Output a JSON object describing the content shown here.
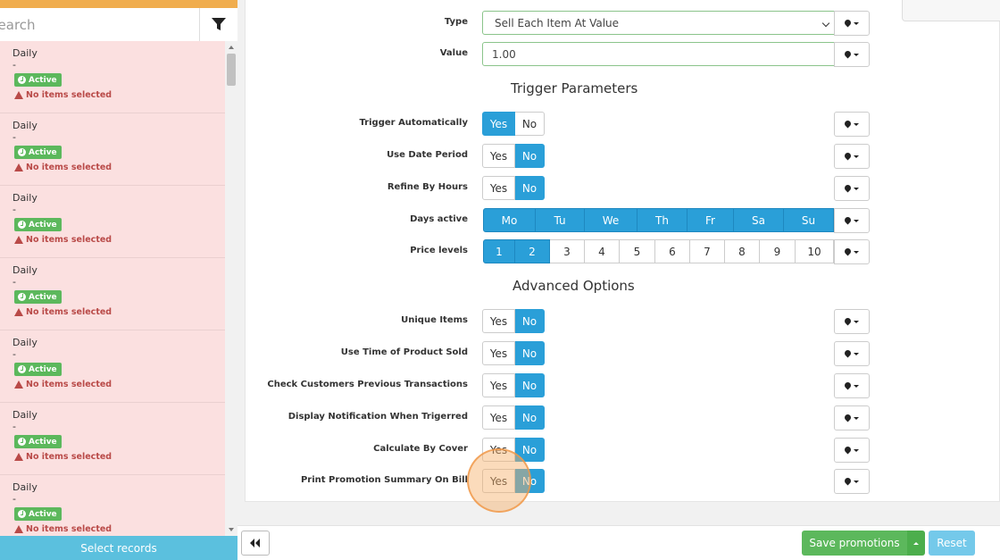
{
  "sidebar": {
    "search_placeholder": "Search",
    "records": [
      {
        "title": "Daily",
        "sub": "-",
        "status": "Active",
        "warning": "No items selected"
      },
      {
        "title": "Daily",
        "sub": "-",
        "status": "Active",
        "warning": "No items selected"
      },
      {
        "title": "Daily",
        "sub": "-",
        "status": "Active",
        "warning": "No items selected"
      },
      {
        "title": "Daily",
        "sub": "-",
        "status": "Active",
        "warning": "No items selected"
      },
      {
        "title": "Daily",
        "sub": "-",
        "status": "Active",
        "warning": "No items selected"
      },
      {
        "title": "Daily",
        "sub": "-",
        "status": "Active",
        "warning": "No items selected"
      },
      {
        "title": "Daily",
        "sub": "-",
        "status": "Active",
        "warning": "No items selected"
      }
    ],
    "select_records_label": "Select records"
  },
  "form": {
    "type": {
      "label": "Type",
      "value": "Sell Each Item At Value"
    },
    "value": {
      "label": "Value",
      "value": "1.00"
    },
    "trigger_section": "Trigger Parameters",
    "trigger_automatically": {
      "label": "Trigger Automatically",
      "yes": "Yes",
      "no": "No",
      "selected": "Yes"
    },
    "use_date_period": {
      "label": "Use Date Period",
      "yes": "Yes",
      "no": "No",
      "selected": "No"
    },
    "refine_by_hours": {
      "label": "Refine By Hours",
      "yes": "Yes",
      "no": "No",
      "selected": "No"
    },
    "days_active": {
      "label": "Days active",
      "days": [
        "Mo",
        "Tu",
        "We",
        "Th",
        "Fr",
        "Sa",
        "Su"
      ]
    },
    "price_levels": {
      "label": "Price levels",
      "levels": [
        "1",
        "2",
        "3",
        "4",
        "5",
        "6",
        "7",
        "8",
        "9",
        "10"
      ],
      "selected": [
        "1",
        "2"
      ]
    },
    "advanced_section": "Advanced Options",
    "unique_items": {
      "label": "Unique Items",
      "yes": "Yes",
      "no": "No",
      "selected": "No"
    },
    "use_time_of_product_sold": {
      "label": "Use Time of Product Sold",
      "yes": "Yes",
      "no": "No",
      "selected": "No"
    },
    "check_customers_previous": {
      "label": "Check Customers Previous Transactions",
      "yes": "Yes",
      "no": "No",
      "selected": "No"
    },
    "display_notification": {
      "label": "Display Notification When Trigerred",
      "yes": "Yes",
      "no": "No",
      "selected": "No"
    },
    "calculate_by_cover": {
      "label": "Calculate By Cover",
      "yes": "Yes",
      "no": "No",
      "selected": "No"
    },
    "print_promotion_summary": {
      "label": "Print Promotion Summary On Bill",
      "yes": "Yes",
      "no": "No",
      "selected": "No"
    }
  },
  "footer": {
    "save_label": "Save promotions",
    "reset_label": "Reset"
  },
  "colors": {
    "accent": "#2a9fd8",
    "success": "#5cb85c",
    "danger": "#b94a48",
    "warning_bar": "#f0ad4e",
    "info": "#5bc0de"
  }
}
